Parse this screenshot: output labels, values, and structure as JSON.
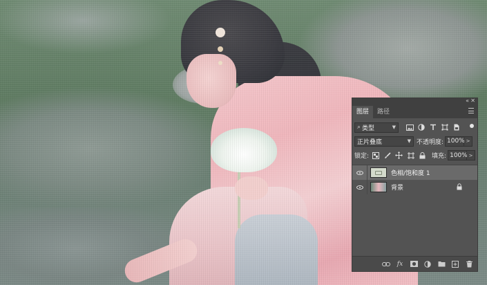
{
  "canvas": {
    "description_icon": "photo-canvas"
  },
  "panel": {
    "topbar": {
      "collapse_label": "«",
      "close_label": "✕"
    },
    "tabs": [
      {
        "label": "图层",
        "active": true
      },
      {
        "label": "路径",
        "active": false
      }
    ],
    "filter": {
      "kind_label": "类型",
      "search_glyph": "⌕",
      "icons": [
        "image-filter-icon",
        "adjustment-filter-icon",
        "type-filter-icon",
        "shape-filter-icon",
        "smart-object-filter-icon"
      ]
    },
    "blend": {
      "mode": "正片叠底",
      "opacity_label": "不透明度:",
      "opacity_value": "100%"
    },
    "lock": {
      "label": "锁定:",
      "icons": [
        "lock-transparent-icon",
        "lock-brush-icon",
        "lock-move-icon",
        "lock-artboard-icon",
        "lock-all-icon"
      ],
      "fill_label": "填充:",
      "fill_value": "100%"
    },
    "layers": [
      {
        "name": "色相/饱和度 1",
        "type": "adjustment",
        "selected": true,
        "visible": true,
        "locked": false
      },
      {
        "name": "背景",
        "type": "photo",
        "selected": false,
        "visible": true,
        "locked": true
      }
    ],
    "footer_icons": [
      "link-layers-icon",
      "fx-icon",
      "mask-icon",
      "adjustment-layer-icon",
      "group-folder-icon",
      "new-layer-icon",
      "delete-layer-icon"
    ],
    "footer_fx_label": "fx"
  },
  "colors": {
    "panel_bg": "#535353",
    "panel_dark": "#404040",
    "selected_row": "#6a6a6a",
    "text": "#e6e6e6"
  }
}
